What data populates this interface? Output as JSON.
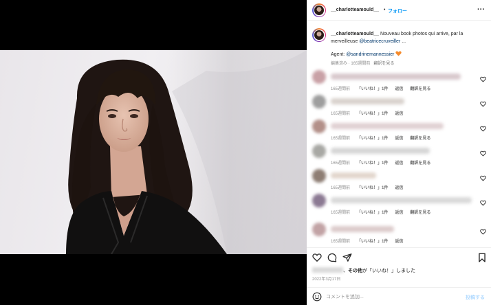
{
  "header": {
    "username": "__charlotteamould__",
    "separator": "•",
    "follow_label": "フォロー",
    "more_label": "···"
  },
  "caption": {
    "username": "__charlotteamould__",
    "text_before_mention": " Nouveau book photos qui arrive, par la merveilleuse ",
    "mention": "@beatricecruveiller",
    "ellipsis": " ...",
    "agent_label": "Agent: ",
    "agent_mention": "@sandrinemannessier",
    "edited": "編集済み · 165週間前",
    "translate": "翻訳を見る"
  },
  "comments": [
    {
      "time": "165週間前",
      "likes": "「いいね！」1件",
      "reply": "返信",
      "translate": "翻訳を見る",
      "avatar_color": "#c9a1a6",
      "text_color": "#d8c8cc",
      "text_len": 0.92
    },
    {
      "time": "165週間前",
      "likes": "「いいね！」1件",
      "reply": "返信",
      "translate": "",
      "avatar_color": "#9e9e9e",
      "text_color": "#d9d2cd",
      "text_len": 0.52
    },
    {
      "time": "165週間前",
      "likes": "「いいね！」1件",
      "reply": "返信",
      "translate": "翻訳を見る",
      "avatar_color": "#b39089",
      "text_color": "#e0d0d2",
      "text_len": 0.8
    },
    {
      "time": "165週間前",
      "likes": "「いいね！」1件",
      "reply": "返信",
      "translate": "翻訳を見る",
      "avatar_color": "#a8a8a4",
      "text_color": "#d6d6d6",
      "text_len": 0.7
    },
    {
      "time": "165週間前",
      "likes": "「いいね！」1件",
      "reply": "返信",
      "translate": "",
      "avatar_color": "#8e7e74",
      "text_color": "#e2d6cc",
      "text_len": 0.32
    },
    {
      "time": "165週間前",
      "likes": "「いいね！」1件",
      "reply": "返信",
      "translate": "翻訳を見る",
      "avatar_color": "#8c7a93",
      "text_color": "#d9d9d9",
      "text_len": 1.0
    },
    {
      "time": "165週間前",
      "likes": "「いいね！」1件",
      "reply": "返信",
      "translate": "",
      "avatar_color": "#c2a3a5",
      "text_color": "#dccbcb",
      "text_len": 0.45
    }
  ],
  "likes": {
    "suffix": "、",
    "others": "その他",
    "text": "が「いいね！」しました"
  },
  "date": "2022年3月17日",
  "add_comment": {
    "placeholder": "コメントを追加...",
    "post_label": "投稿する"
  },
  "colors": {
    "accent": "#0095f6",
    "link": "#00376b",
    "muted": "#8e8e8e",
    "post_disabled": "#b3dbff",
    "media_bg": "#000000"
  }
}
